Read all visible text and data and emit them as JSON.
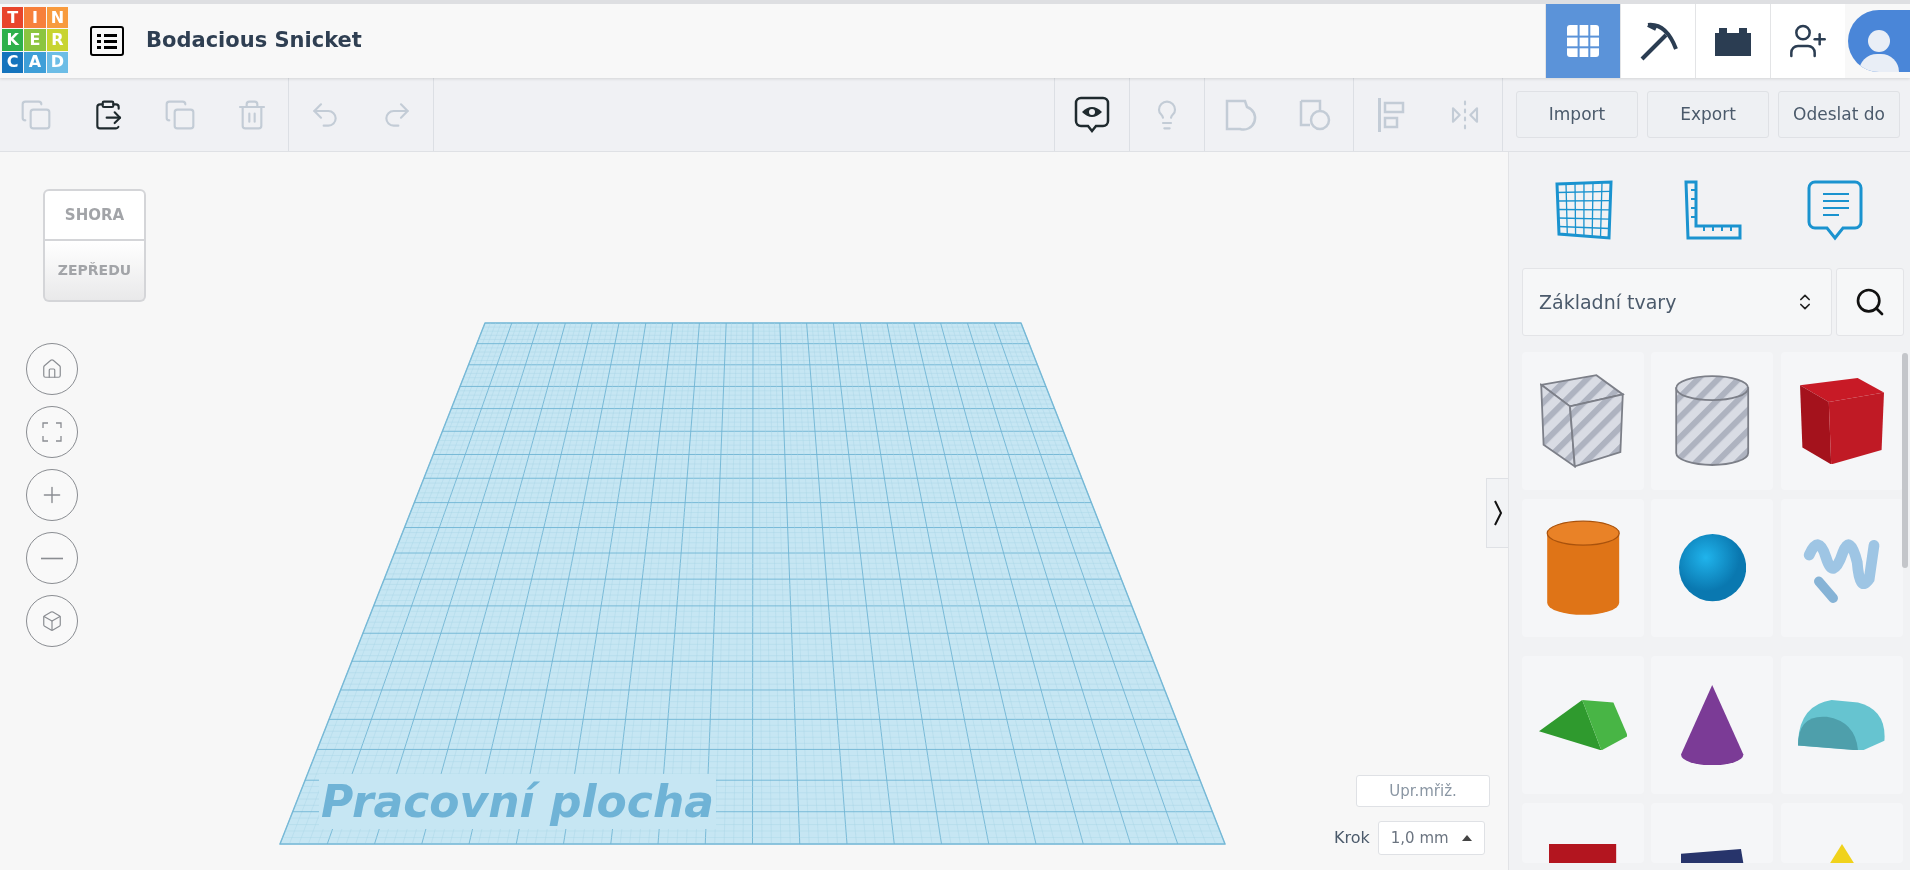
{
  "logo": {
    "tiles": [
      {
        "letter": "T",
        "color": "#e8452c"
      },
      {
        "letter": "I",
        "color": "#f7803b"
      },
      {
        "letter": "N",
        "color": "#f89b3e"
      },
      {
        "letter": "K",
        "color": "#2eb04b"
      },
      {
        "letter": "E",
        "color": "#8cc540"
      },
      {
        "letter": "R",
        "color": "#c8d430"
      },
      {
        "letter": "C",
        "color": "#1574bd"
      },
      {
        "letter": "A",
        "color": "#3f9fd8"
      },
      {
        "letter": "D",
        "color": "#6dbde6"
      }
    ]
  },
  "header": {
    "title": "Bodacious Snicket",
    "nav": [
      {
        "kind": "grid",
        "selected": true
      },
      {
        "kind": "pickaxe",
        "selected": false
      },
      {
        "kind": "brick",
        "selected": false
      },
      {
        "kind": "add-user",
        "selected": false
      }
    ]
  },
  "toolbar": {
    "left": [
      [
        {
          "kind": "copy",
          "disabled": true
        },
        {
          "kind": "paste",
          "disabled": false
        },
        {
          "kind": "duplicate",
          "disabled": true
        },
        {
          "kind": "delete",
          "disabled": true
        }
      ],
      [
        {
          "kind": "undo",
          "disabled": true
        },
        {
          "kind": "redo",
          "disabled": true
        }
      ]
    ],
    "right": [
      [
        {
          "kind": "notes",
          "disabled": false
        }
      ],
      [
        {
          "kind": "bulb",
          "disabled": true
        }
      ],
      [
        {
          "kind": "group",
          "disabled": true
        },
        {
          "kind": "ungroup",
          "disabled": true
        }
      ],
      [
        {
          "kind": "align",
          "disabled": true
        },
        {
          "kind": "mirror",
          "disabled": true
        }
      ]
    ],
    "actions": [
      "Import",
      "Export",
      "Odeslat do"
    ]
  },
  "viewcube": {
    "top": "SHORA",
    "front": "ZEPŘEDU"
  },
  "nav_controls": [
    {
      "kind": "home"
    },
    {
      "kind": "fit"
    },
    {
      "kind": "zoom-in"
    },
    {
      "kind": "zoom-out"
    },
    {
      "kind": "perspective"
    }
  ],
  "workplane": {
    "label": "Pracovní plocha"
  },
  "grid_settings": {
    "edit": "Upr.mřiž.",
    "step_label": "Krok",
    "step_value": "1,0 mm"
  },
  "panel": {
    "tools": [
      {
        "kind": "workplane"
      },
      {
        "kind": "ruler"
      },
      {
        "kind": "note"
      }
    ],
    "category": "Základní tvary",
    "shapes": [
      {
        "kind": "box-hole"
      },
      {
        "kind": "cylinder-hole"
      },
      {
        "kind": "box"
      },
      {
        "kind": "cylinder"
      },
      {
        "kind": "sphere"
      },
      {
        "kind": "scribble"
      },
      {
        "kind": "roof"
      },
      {
        "kind": "cone"
      },
      {
        "kind": "round-roof"
      },
      {
        "kind": "text"
      },
      {
        "kind": "wedge"
      },
      {
        "kind": "pyramid"
      }
    ]
  }
}
